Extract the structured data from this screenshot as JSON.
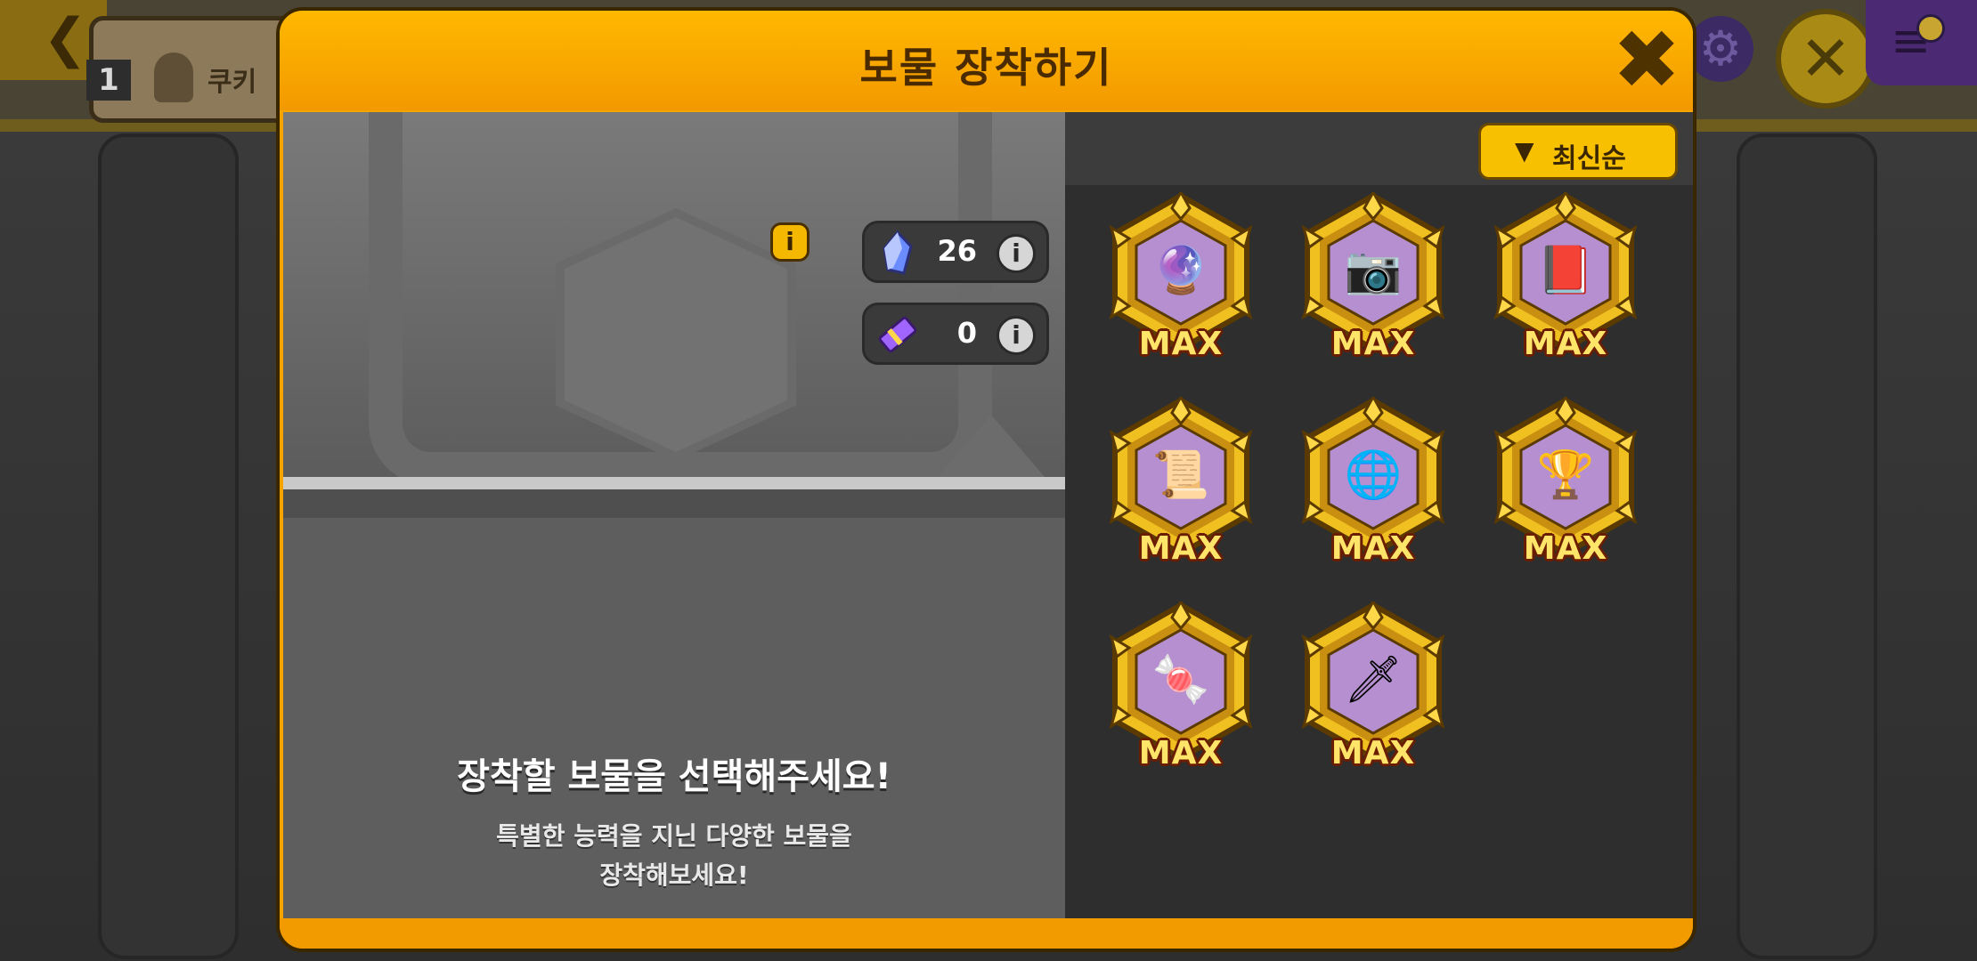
{
  "background": {
    "back_glyph": "❮",
    "tab_number": "1",
    "tab_label": "쿠키",
    "gear_glyph": "⚙",
    "close_glyph": "✕",
    "menu_glyph": "≡"
  },
  "modal": {
    "title": "보물 장착하기",
    "close_glyph": "✖"
  },
  "slot": {
    "info_glyph": "i"
  },
  "resources": [
    {
      "icon": "blue-crystal-icon",
      "value": "26",
      "info_glyph": "i"
    },
    {
      "icon": "purple-ticket-icon",
      "value": "0",
      "info_glyph": "i"
    }
  ],
  "empty_state": {
    "title": "장착할 보물을 선택해주세요!",
    "desc_line1": "특별한 능력을 지닌 다양한 보물을",
    "desc_line2": "장착해보세요!"
  },
  "sort": {
    "arrow": "▼",
    "label": "최신순"
  },
  "treasures": [
    {
      "icon": "purple-orb-icon",
      "level": "MAX",
      "glyph": "🔮"
    },
    {
      "icon": "camera-icon",
      "level": "MAX",
      "glyph": "📷"
    },
    {
      "icon": "red-book-icon",
      "level": "MAX",
      "glyph": "📕"
    },
    {
      "icon": "scroll-map-icon",
      "level": "MAX",
      "glyph": "📜"
    },
    {
      "icon": "armillary-sphere-icon",
      "level": "MAX",
      "glyph": "🌐"
    },
    {
      "icon": "golden-chalice-icon",
      "level": "MAX",
      "glyph": "🏆"
    },
    {
      "icon": "star-candy-icon",
      "level": "MAX",
      "glyph": "🍬"
    },
    {
      "icon": "dagger-icon",
      "level": "MAX",
      "glyph": "🗡"
    }
  ],
  "colors": {
    "modal_orange": "#f5a400",
    "button_yellow": "#f7c000",
    "max_text": "#ffe46a",
    "panel_dark": "#2e2e2e"
  }
}
